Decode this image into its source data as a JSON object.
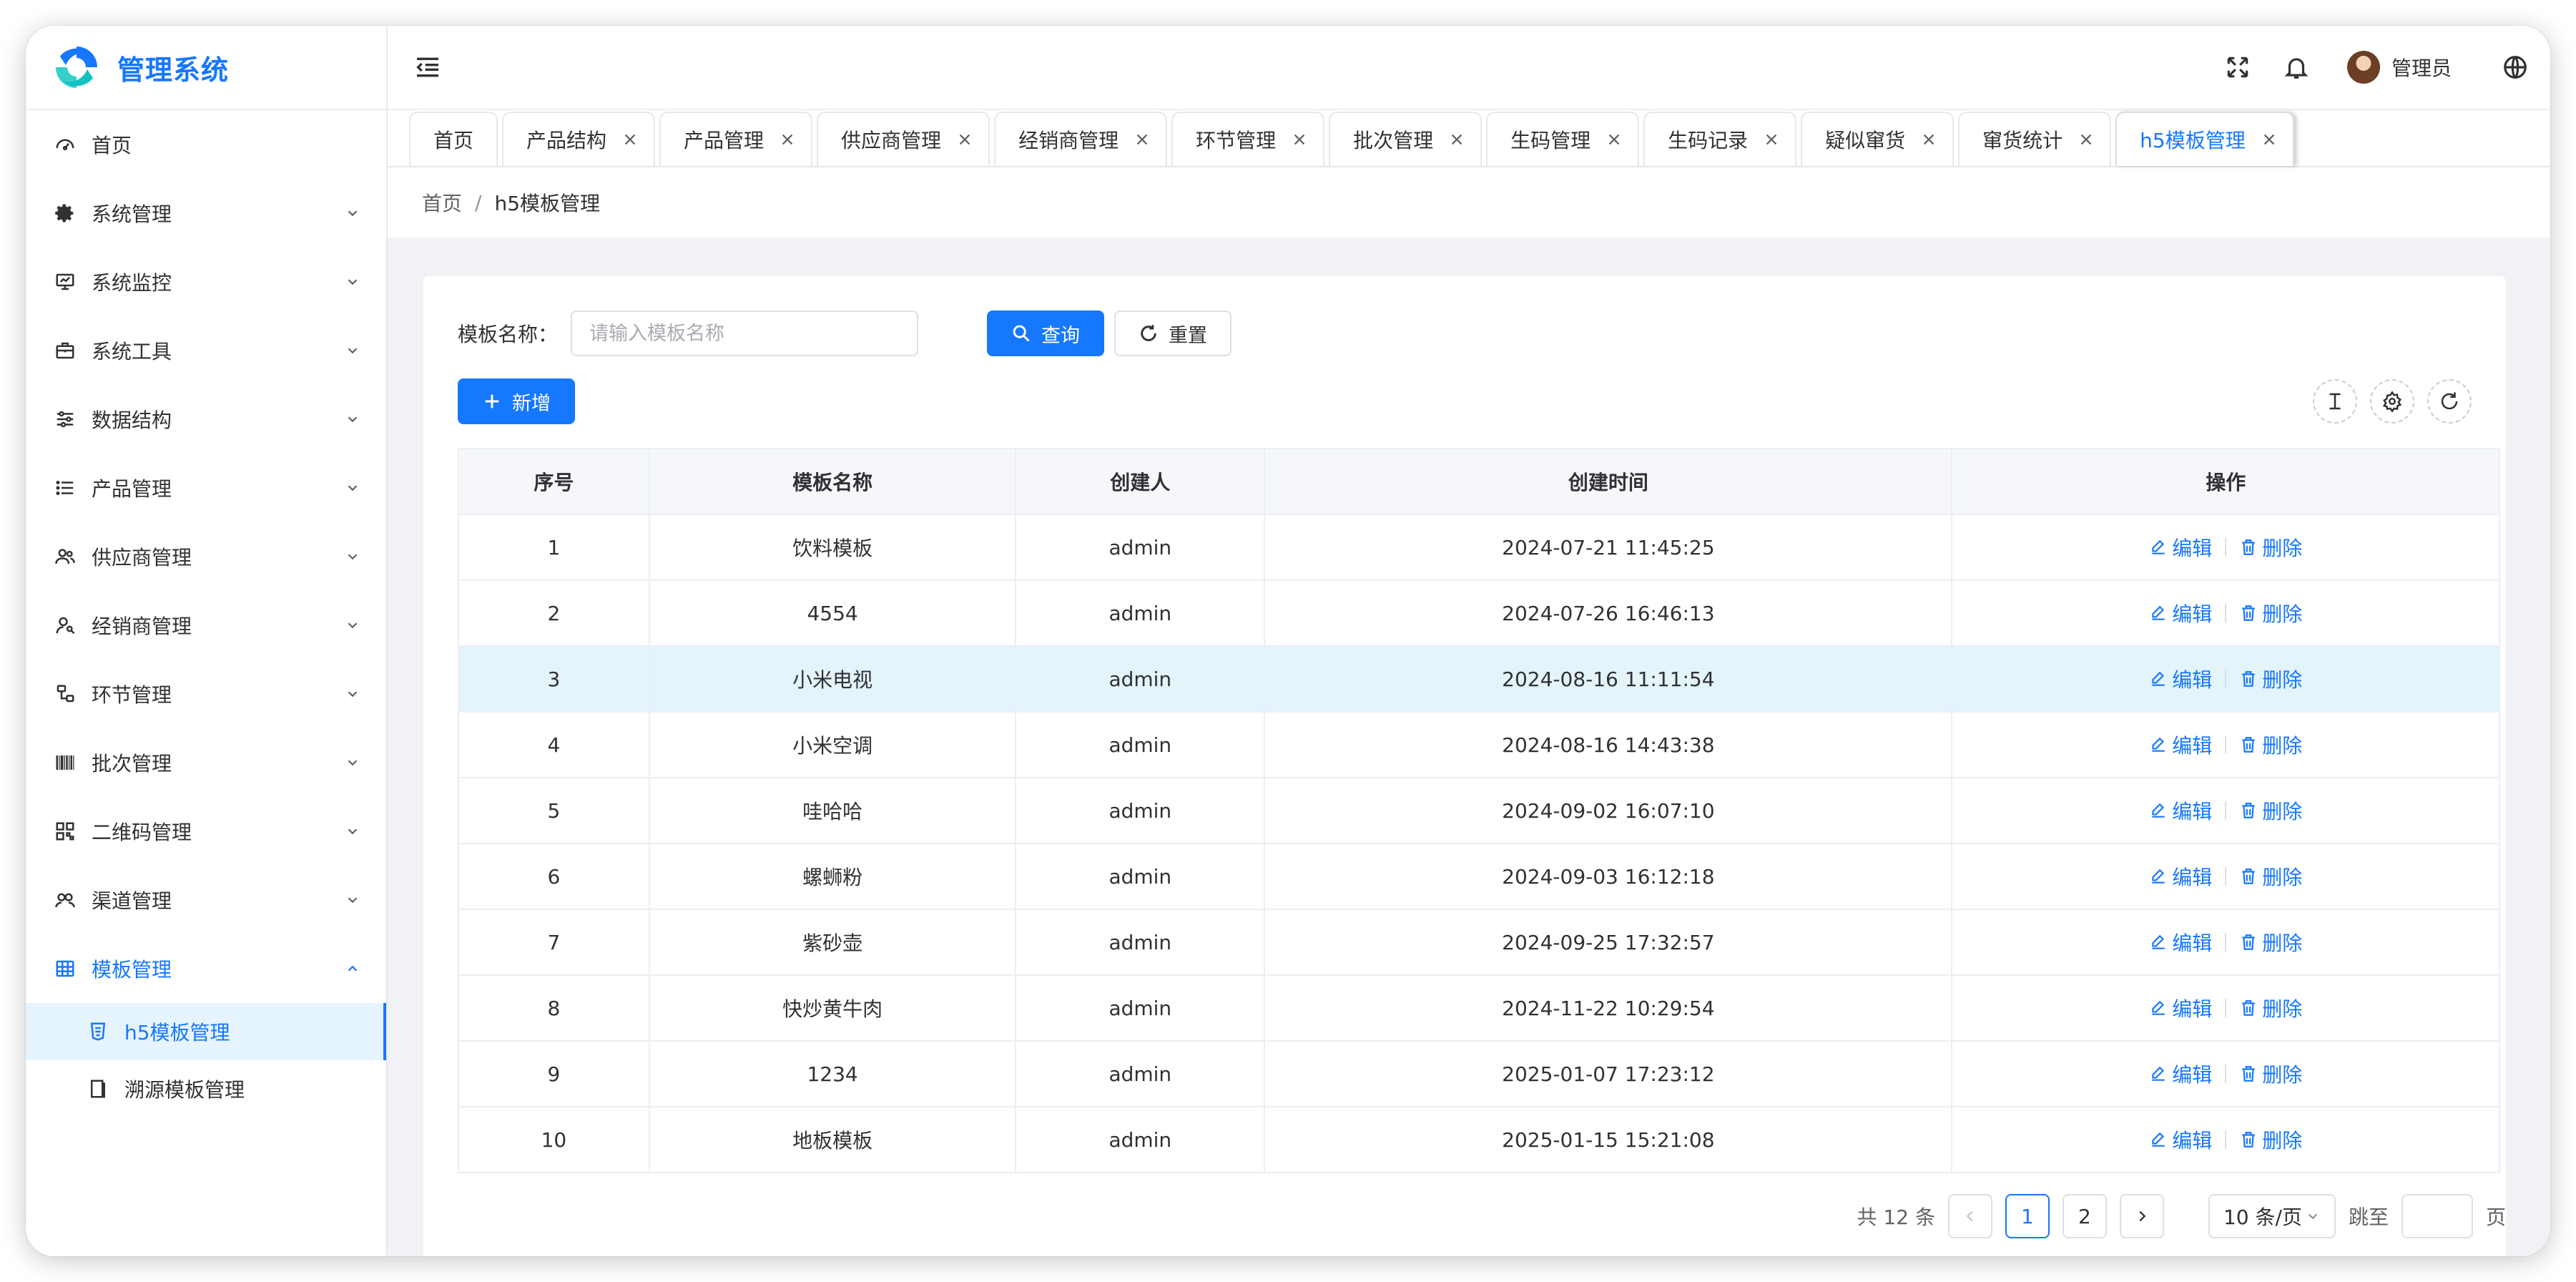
{
  "app": {
    "title": "管理系统"
  },
  "colors": {
    "primary": "#1677ff",
    "highlight_row": "#e3f4fb",
    "active_menu_bg": "#e6f4ff"
  },
  "sidebar": {
    "items": [
      {
        "label": "首页",
        "icon": "dashboard-icon",
        "has_children": false
      },
      {
        "label": "系统管理",
        "icon": "gear-icon",
        "has_children": true
      },
      {
        "label": "系统监控",
        "icon": "monitor-icon",
        "has_children": true
      },
      {
        "label": "系统工具",
        "icon": "toolbox-icon",
        "has_children": true
      },
      {
        "label": "数据结构",
        "icon": "sliders-icon",
        "has_children": true
      },
      {
        "label": "产品管理",
        "icon": "list-icon",
        "has_children": true
      },
      {
        "label": "供应商管理",
        "icon": "users-icon",
        "has_children": true
      },
      {
        "label": "经销商管理",
        "icon": "user-key-icon",
        "has_children": true
      },
      {
        "label": "环节管理",
        "icon": "flow-icon",
        "has_children": true
      },
      {
        "label": "批次管理",
        "icon": "barcode-icon",
        "has_children": true
      },
      {
        "label": "二维码管理",
        "icon": "qrcode-icon",
        "has_children": true
      },
      {
        "label": "渠道管理",
        "icon": "channel-icon",
        "has_children": true
      },
      {
        "label": "模板管理",
        "icon": "table-icon",
        "has_children": true,
        "open": true
      }
    ],
    "subitems": [
      {
        "label": "h5模板管理",
        "icon": "h5-icon",
        "active": true
      },
      {
        "label": "溯源模板管理",
        "icon": "book-icon",
        "active": false
      }
    ]
  },
  "topbar": {
    "user_name": "管理员"
  },
  "tabs": [
    {
      "label": "首页",
      "closable": false
    },
    {
      "label": "产品结构",
      "closable": true
    },
    {
      "label": "产品管理",
      "closable": true
    },
    {
      "label": "供应商管理",
      "closable": true
    },
    {
      "label": "经销商管理",
      "closable": true
    },
    {
      "label": "环节管理",
      "closable": true
    },
    {
      "label": "批次管理",
      "closable": true
    },
    {
      "label": "生码管理",
      "closable": true
    },
    {
      "label": "生码记录",
      "closable": true
    },
    {
      "label": "疑似窜货",
      "closable": true
    },
    {
      "label": "窜货统计",
      "closable": true
    },
    {
      "label": "h5模板管理",
      "closable": true,
      "active": true
    }
  ],
  "breadcrumb": {
    "home": "首页",
    "separator": "/",
    "current": "h5模板管理"
  },
  "search": {
    "label": "模板名称：",
    "placeholder": "请输入模板名称",
    "value": "",
    "query_label": "查询",
    "reset_label": "重置"
  },
  "toolbar": {
    "add_label": "新增"
  },
  "table": {
    "columns": [
      "序号",
      "模板名称",
      "创建人",
      "创建时间",
      "操作"
    ],
    "rows": [
      {
        "index": "1",
        "name": "饮料模板",
        "creator": "admin",
        "created": "2024-07-21 11:45:25"
      },
      {
        "index": "2",
        "name": "4554",
        "creator": "admin",
        "created": "2024-07-26 16:46:13"
      },
      {
        "index": "3",
        "name": "小米电视",
        "creator": "admin",
        "created": "2024-08-16 11:11:54",
        "highlight": true
      },
      {
        "index": "4",
        "name": "小米空调",
        "creator": "admin",
        "created": "2024-08-16 14:43:38"
      },
      {
        "index": "5",
        "name": "哇哈哈",
        "creator": "admin",
        "created": "2024-09-02 16:07:10"
      },
      {
        "index": "6",
        "name": "螺蛳粉",
        "creator": "admin",
        "created": "2024-09-03 16:12:18"
      },
      {
        "index": "7",
        "name": "紫砂壶",
        "creator": "admin",
        "created": "2024-09-25 17:32:57"
      },
      {
        "index": "8",
        "name": "快炒黄牛肉",
        "creator": "admin",
        "created": "2024-11-22 10:29:54"
      },
      {
        "index": "9",
        "name": "1234",
        "creator": "admin",
        "created": "2025-01-07 17:23:12"
      },
      {
        "index": "10",
        "name": "地板模板",
        "creator": "admin",
        "created": "2025-01-15 15:21:08"
      }
    ],
    "actions": {
      "edit": "编辑",
      "delete": "删除"
    }
  },
  "pagination": {
    "total_text": "共 12 条",
    "pages": [
      "1",
      "2"
    ],
    "current_page": "1",
    "page_size": "10 条/页",
    "jump_label": "跳至",
    "page_suffix": "页"
  }
}
